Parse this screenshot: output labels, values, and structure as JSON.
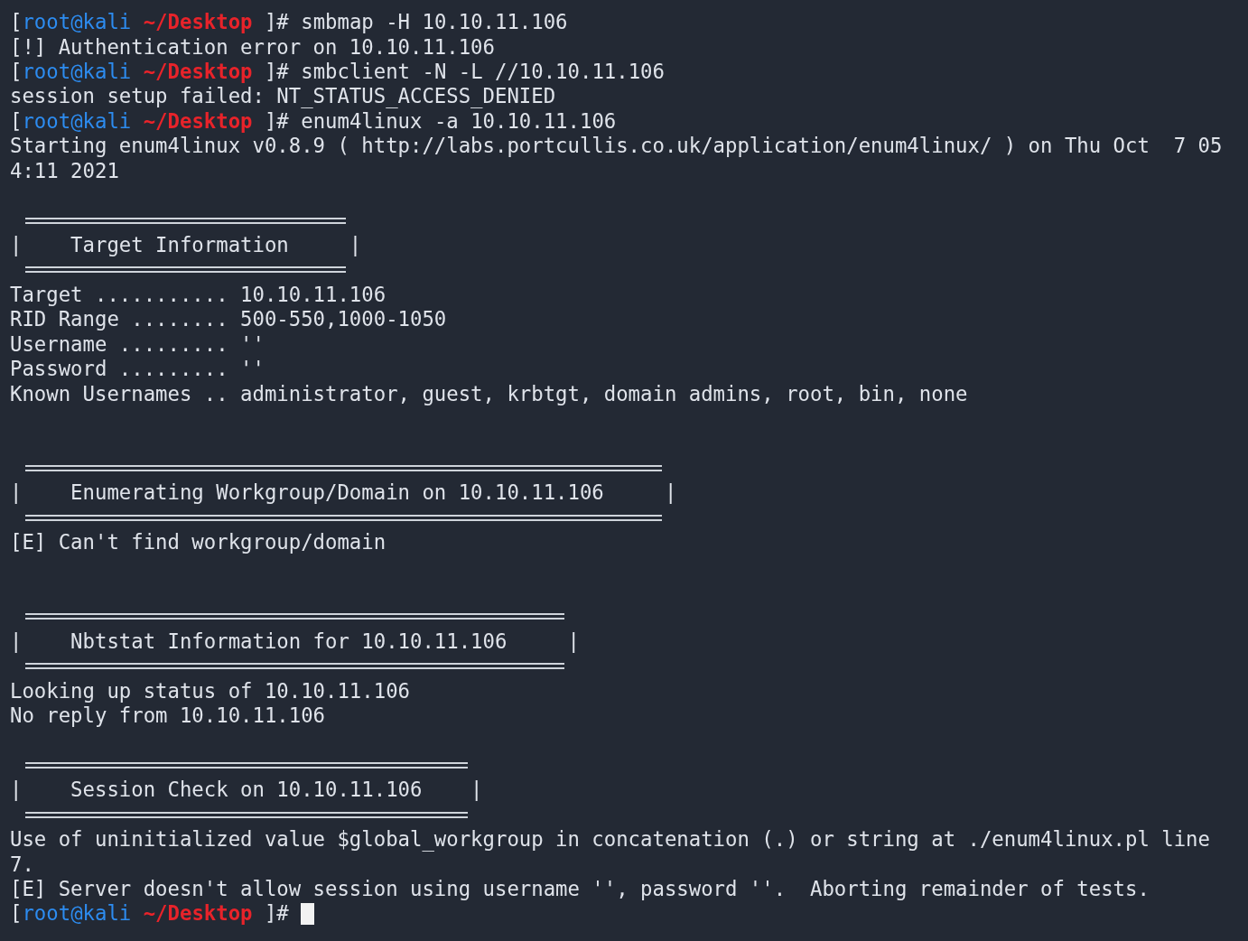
{
  "terminal": {
    "lines": [
      {
        "kind": "prompt",
        "open": "[",
        "user": "root@kali",
        "path": "~/Desktop",
        "symbol": "]#",
        "command": "smbmap -H 10.10.11.106"
      },
      {
        "kind": "output",
        "text": "[!] Authentication error on 10.10.11.106"
      },
      {
        "kind": "prompt",
        "open": "[",
        "user": "root@kali",
        "path": "~/Desktop",
        "symbol": "]#",
        "command": "smbclient -N -L //10.10.11.106"
      },
      {
        "kind": "output",
        "text": "session setup failed: NT_STATUS_ACCESS_DENIED"
      },
      {
        "kind": "prompt",
        "open": "[",
        "user": "root@kali",
        "path": "~/Desktop",
        "symbol": "]#",
        "command": "enum4linux -a 10.10.11.106"
      },
      {
        "kind": "output",
        "text": "Starting enum4linux v0.8.9 ( http://labs.portcullis.co.uk/application/enum4linux/ ) on Thu Oct  7 05"
      },
      {
        "kind": "output",
        "text": "4:11 2021"
      },
      {
        "kind": "blank"
      },
      {
        "kind": "banner",
        "text": "|    Target Information     |"
      },
      {
        "kind": "output",
        "text": "Target ........... 10.10.11.106"
      },
      {
        "kind": "output",
        "text": "RID Range ........ 500-550,1000-1050"
      },
      {
        "kind": "output",
        "text": "Username ......... ''"
      },
      {
        "kind": "output",
        "text": "Password ......... ''"
      },
      {
        "kind": "output",
        "text": "Known Usernames .. administrator, guest, krbtgt, domain admins, root, bin, none"
      },
      {
        "kind": "blank"
      },
      {
        "kind": "blank"
      },
      {
        "kind": "banner",
        "text": "|    Enumerating Workgroup/Domain on 10.10.11.106     |"
      },
      {
        "kind": "output",
        "text": "[E] Can't find workgroup/domain"
      },
      {
        "kind": "blank"
      },
      {
        "kind": "blank"
      },
      {
        "kind": "banner",
        "text": "|    Nbtstat Information for 10.10.11.106     |"
      },
      {
        "kind": "output",
        "text": "Looking up status of 10.10.11.106"
      },
      {
        "kind": "output",
        "text": "No reply from 10.10.11.106"
      },
      {
        "kind": "blank"
      },
      {
        "kind": "banner",
        "text": "|    Session Check on 10.10.11.106    |"
      },
      {
        "kind": "output",
        "text": "Use of uninitialized value $global_workgroup in concatenation (.) or string at ./enum4linux.pl line"
      },
      {
        "kind": "output",
        "text": "7."
      },
      {
        "kind": "output",
        "text": "[E] Server doesn't allow session using username '', password ''.  Aborting remainder of tests."
      },
      {
        "kind": "prompt",
        "open": "[",
        "user": "root@kali",
        "path": "~/Desktop",
        "symbol": "]#",
        "cursor": true
      }
    ]
  }
}
